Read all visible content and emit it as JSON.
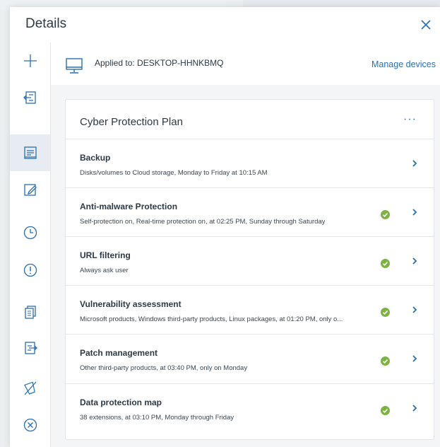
{
  "header": {
    "title": "Details"
  },
  "sidebar": {
    "items": [
      {
        "icon": "plus-icon"
      },
      {
        "icon": "apply-plan-icon"
      },
      {
        "icon": "plan-details-icon",
        "active": true
      },
      {
        "icon": "edit-icon"
      },
      {
        "icon": "clock-icon"
      },
      {
        "icon": "alert-icon"
      },
      {
        "icon": "copy-icon"
      },
      {
        "icon": "export-icon"
      },
      {
        "icon": "disable-icon"
      },
      {
        "icon": "revoke-icon"
      }
    ]
  },
  "applied": {
    "label": "Applied to: DESKTOP-HHNKBMQ",
    "manage_label": "Manage devices"
  },
  "plan": {
    "title": "Cyber Protection Plan",
    "more_label": "···",
    "modules": [
      {
        "title": "Backup",
        "description": "Disks/volumes to Cloud storage, Monday to Friday at 10:15 AM",
        "status_ok": false
      },
      {
        "title": "Anti-malware Protection",
        "description": "Self-protection on, Real-time protection on, at 02:25 PM, Sunday through Saturday",
        "status_ok": true
      },
      {
        "title": "URL filtering",
        "description": "Always ask user",
        "status_ok": true
      },
      {
        "title": "Vulnerability assessment",
        "description": "Microsoft products, Windows third-party products, Linux packages, at 01:20 PM, only o...",
        "status_ok": true
      },
      {
        "title": "Patch management",
        "description": "Other third-party products, at 03:40 PM, only on Monday",
        "status_ok": true
      },
      {
        "title": "Data protection map",
        "description": "38 extensions, at 03:10 PM, Monday through Friday",
        "status_ok": true
      }
    ]
  },
  "colors": {
    "accent": "#2a6fb0",
    "ok": "#7cb342",
    "text": "#2d3a44",
    "sidebar_active": "#e7ecf2"
  }
}
